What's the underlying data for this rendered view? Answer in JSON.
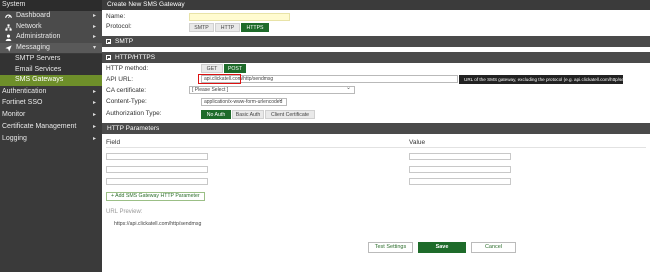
{
  "sidebar": {
    "system": "System",
    "items": [
      {
        "label": "Dashboard",
        "icon": "dashboard-icon"
      },
      {
        "label": "Network",
        "icon": "network-icon"
      },
      {
        "label": "Administration",
        "icon": "user-icon"
      },
      {
        "label": "Messaging",
        "icon": "send-icon"
      }
    ],
    "sub_items": [
      "SMTP Servers",
      "Email Services",
      "SMS Gateways"
    ],
    "bottom_items": [
      "Authentication",
      "Fortinet SSO",
      "Monitor",
      "Certificate Management",
      "Logging"
    ],
    "active_color": "#6e8f2a"
  },
  "header": {
    "title": "Create New SMS Gateway"
  },
  "form": {
    "name_label": "Name:",
    "name_value": "",
    "protocol_label": "Protocol:",
    "protocols": [
      "SMTP",
      "HTTP",
      "HTTPS"
    ],
    "protocol_selected": "HTTPS"
  },
  "smtp_section": {
    "title": "SMTP"
  },
  "http_section": {
    "title": "HTTP/HTTPS",
    "method_label": "HTTP method:",
    "methods": [
      "GET",
      "POST"
    ],
    "method_selected": "POST",
    "api_url_label": "API URL:",
    "api_host": "api.clickatell.com",
    "api_path": "/http/sendmsg",
    "api_tooltip": "URL of the SMS gateway, excluding the protocol (e.g. api.clickatell.com/http/sendmsg/)",
    "ca_label": "CA certificate:",
    "ca_value": "[ Please Select ]",
    "content_type_label": "Content-Type:",
    "content_type_value": "application/x-www-form-urlencoded",
    "auth_label": "Authorization Type:",
    "auth_options": [
      "No Auth",
      "Basic Auth",
      "Client Certificate"
    ],
    "auth_selected": "No Auth"
  },
  "params_section": {
    "title": "HTTP Parameters",
    "field_header": "Field",
    "value_header": "Value",
    "add_button": "+ Add SMS Gateway HTTP Parameter",
    "rows": [
      {
        "field": "",
        "value": ""
      },
      {
        "field": "",
        "value": ""
      },
      {
        "field": "",
        "value": ""
      },
      {
        "field": "",
        "value": ""
      }
    ]
  },
  "preview": {
    "label": "URL Preview:",
    "value": "https://api.clickatell.com/http/sendmsg"
  },
  "actions": {
    "test": "Test Settings",
    "save": "Save",
    "cancel": "Cancel"
  }
}
